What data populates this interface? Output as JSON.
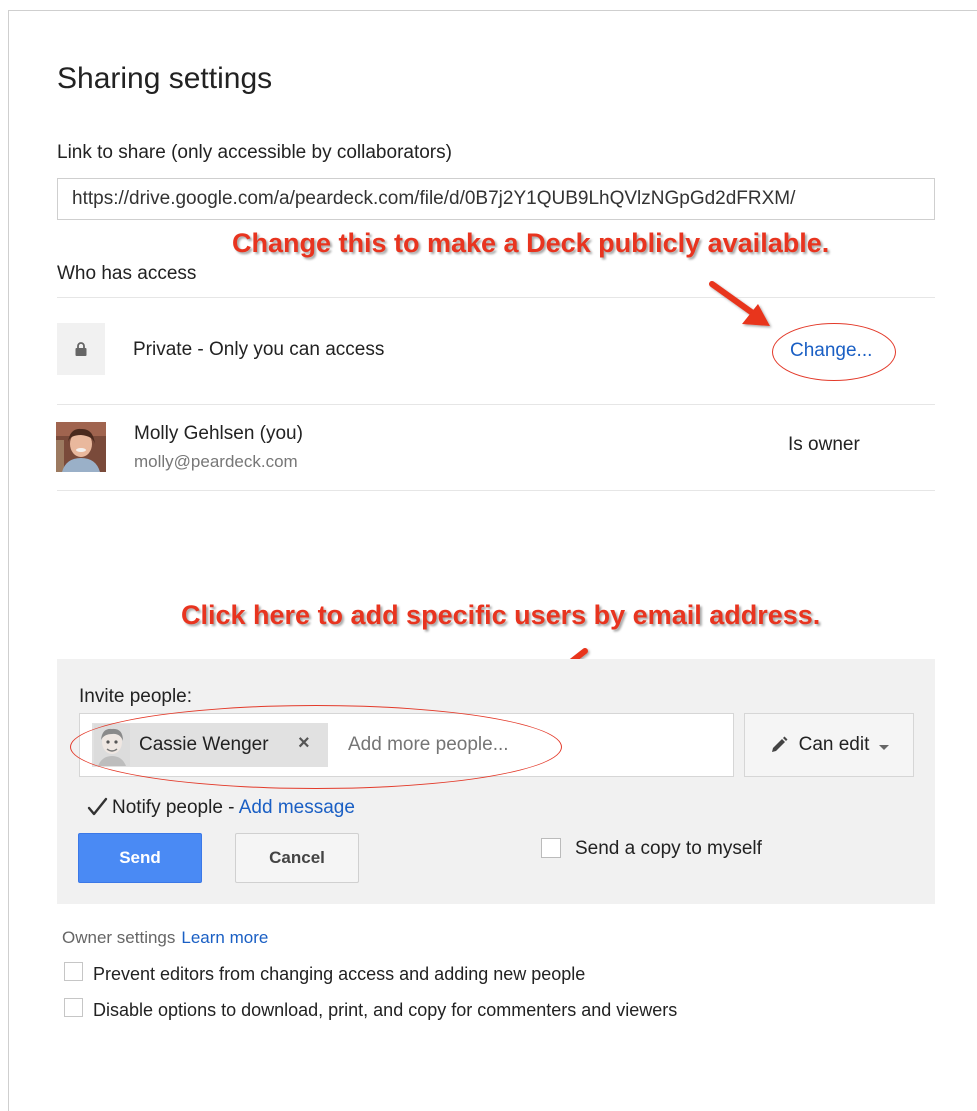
{
  "dialog": {
    "title": "Sharing settings",
    "link_label": "Link to share (only accessible by collaborators)",
    "link_url": "https://drive.google.com/a/peardeck.com/file/d/0B7j2Y1QUB9LhQVlzNGpGd2dFRXM/"
  },
  "access": {
    "label": "Who has access",
    "private_text": "Private - Only you can access",
    "change_label": "Change...",
    "owner": {
      "name": "Molly Gehlsen (you)",
      "email": "molly@peardeck.com",
      "role": "Is owner"
    }
  },
  "annotations": {
    "change_hint": "Change this to make a Deck publicly available.",
    "invite_hint": "Click here to add specific users by email address."
  },
  "invite": {
    "label": "Invite people:",
    "chip_name": "Cassie Wenger",
    "chip_close": "×",
    "placeholder": "Add more people...",
    "permission": "Can edit",
    "notify_text": "Notify people - ",
    "add_message": "Add message",
    "send": "Send",
    "cancel": "Cancel",
    "copy_to_self": "Send a copy to myself"
  },
  "owner_settings": {
    "label": "Owner settings",
    "learn_more": "Learn more",
    "option1": "Prevent editors from changing access and adding new people",
    "option2": "Disable options to download, print, and copy for commenters and viewers"
  },
  "colors": {
    "accent": "#1a5fc4",
    "annotation": "#e8341f",
    "send_button": "#4a8af4"
  }
}
